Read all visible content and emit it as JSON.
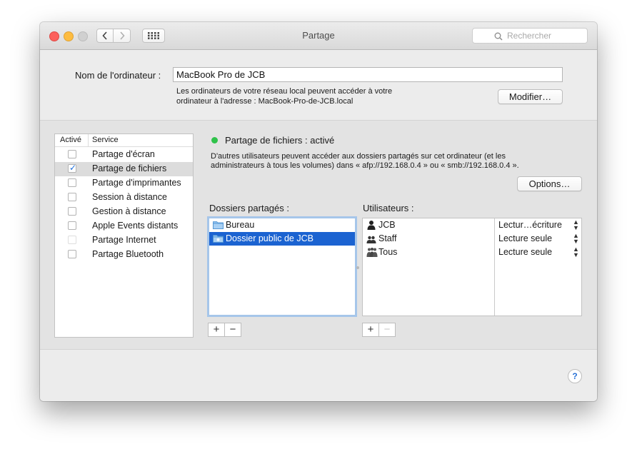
{
  "window": {
    "title": "Partage",
    "search_placeholder": "Rechercher"
  },
  "computer": {
    "name_label": "Nom de l'ordinateur :",
    "name_value": "MacBook Pro de JCB",
    "description_line1": "Les ordinateurs de votre réseau local peuvent accéder à votre",
    "description_line2": "ordinateur à l'adresse : MacBook-Pro-de-JCB.local",
    "modify_button": "Modifier…"
  },
  "services": {
    "header_active": "Activé",
    "header_service": "Service",
    "items": [
      {
        "label": "Partage d'écran",
        "checked": false,
        "dim": false
      },
      {
        "label": "Partage de fichiers",
        "checked": true,
        "dim": false
      },
      {
        "label": "Partage d'imprimantes",
        "checked": false,
        "dim": false
      },
      {
        "label": "Session à distance",
        "checked": false,
        "dim": false
      },
      {
        "label": "Gestion à distance",
        "checked": false,
        "dim": false
      },
      {
        "label": "Apple Events distants",
        "checked": false,
        "dim": false
      },
      {
        "label": "Partage Internet",
        "checked": false,
        "dim": true
      },
      {
        "label": "Partage Bluetooth",
        "checked": false,
        "dim": false
      }
    ]
  },
  "detail": {
    "status": "Partage de fichiers : activé",
    "status_color": "#2fc24a",
    "info_line1": "D'autres utilisateurs peuvent accéder aux dossiers partagés sur cet ordinateur (et les",
    "info_line2": "administrateurs à tous les volumes) dans « afp://192.168.0.4 » ou « smb://192.168.0.4 ».",
    "options_button": "Options…",
    "shared_folders_label": "Dossiers partagés :",
    "users_label": "Utilisateurs :",
    "folders": [
      {
        "name": "Bureau",
        "icon": "folder-icon",
        "selected": false
      },
      {
        "name": "Dossier public de JCB",
        "icon": "public-folder-icon",
        "selected": true
      }
    ],
    "users": [
      {
        "name": "JCB",
        "icon": "user-icon",
        "permission": "Lectur…écriture"
      },
      {
        "name": "Staff",
        "icon": "group-icon",
        "permission": "Lecture seule"
      },
      {
        "name": "Tous",
        "icon": "everyone-icon",
        "permission": "Lecture seule"
      }
    ],
    "add_symbol": "+",
    "remove_symbol": "−"
  },
  "help": {
    "symbol": "?"
  }
}
